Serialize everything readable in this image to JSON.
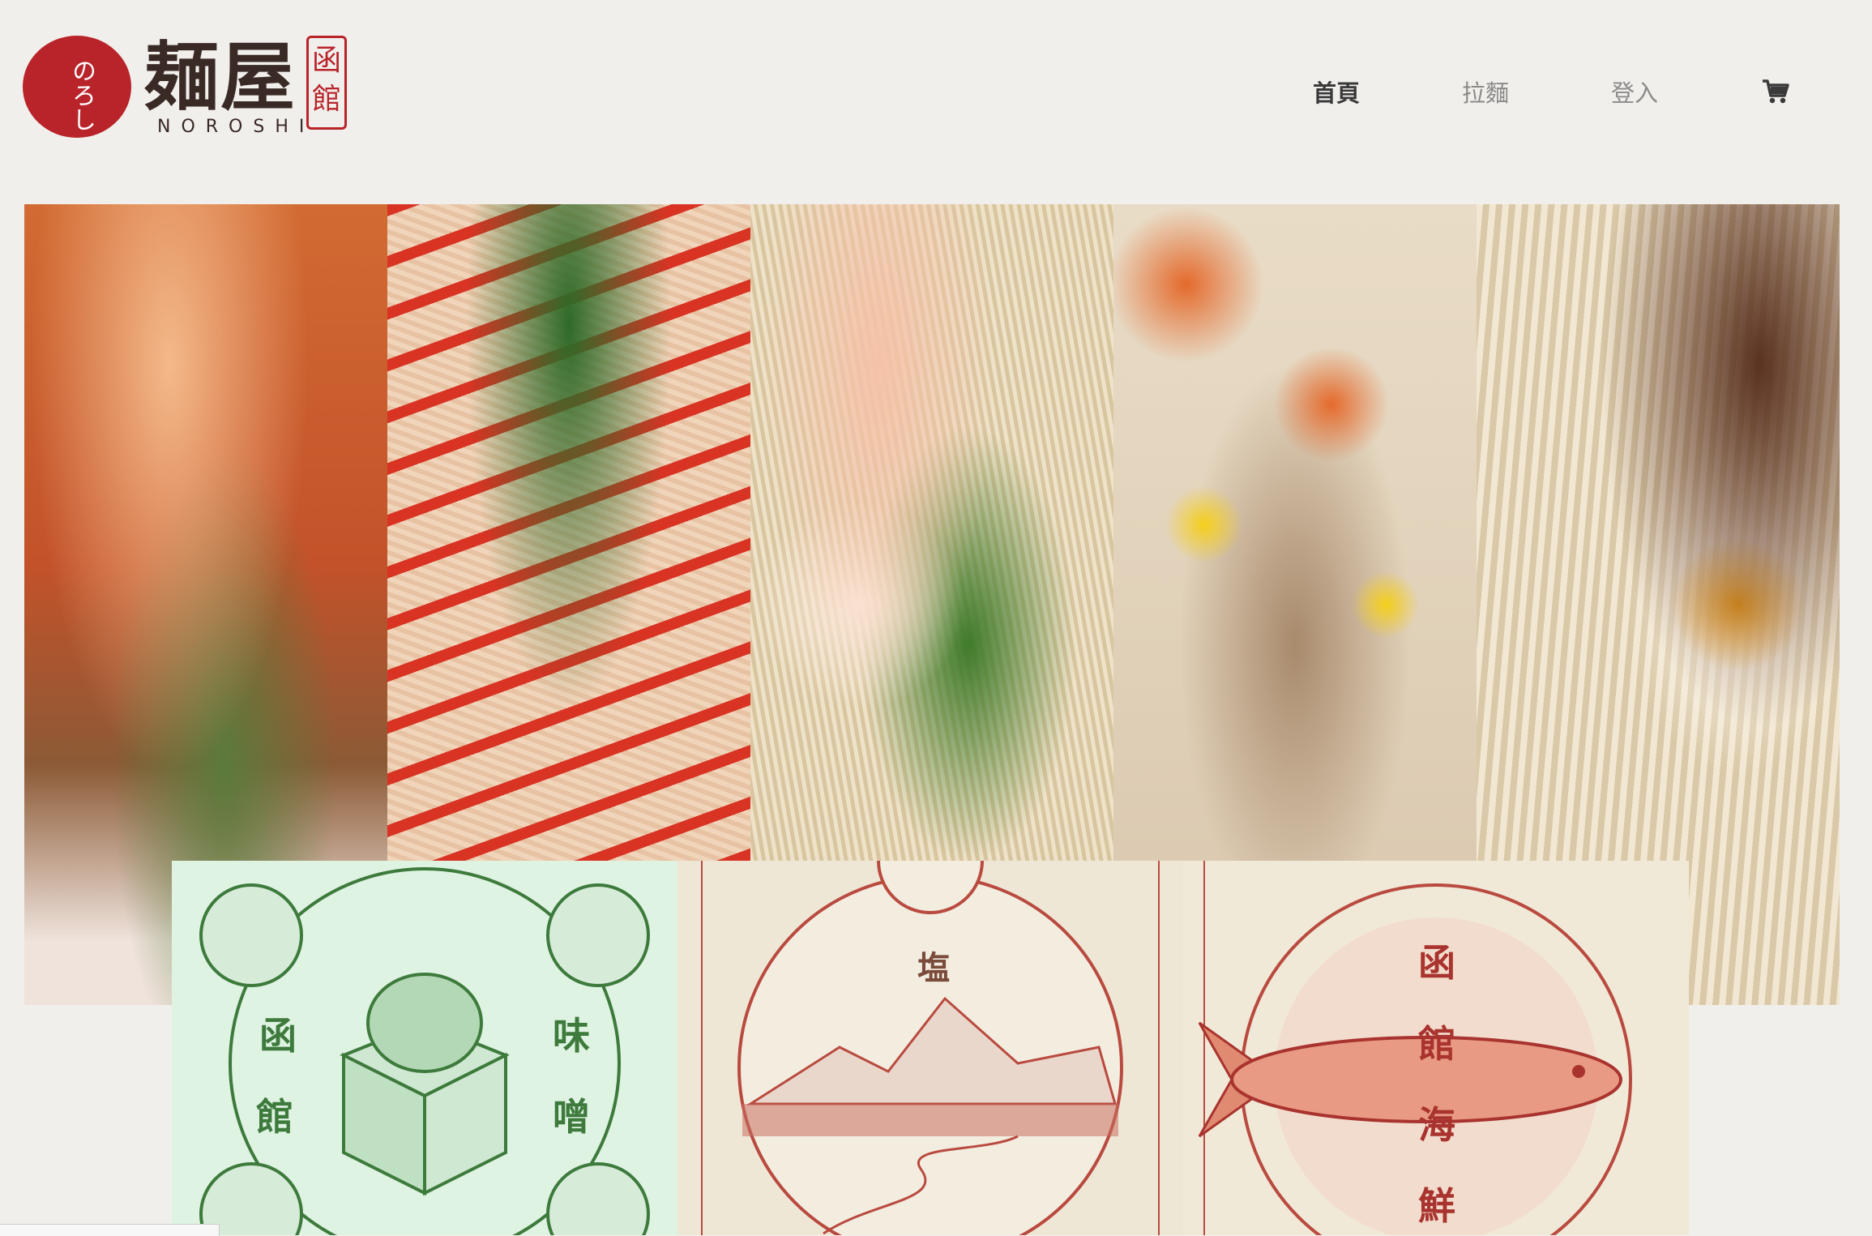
{
  "brand": {
    "kana": "のろし",
    "title": "麺屋",
    "seal": "函館",
    "sub": "NOROSHI",
    "accent": "#b8242a"
  },
  "nav": {
    "items": [
      {
        "label": "首頁",
        "active": true
      },
      {
        "label": "拉麵",
        "active": false
      },
      {
        "label": "登入",
        "active": false
      }
    ],
    "cart_icon": "shopping-cart-icon"
  },
  "cards": {
    "left": {
      "chars": [
        "函",
        "館",
        "味",
        "噌"
      ]
    },
    "middle": {
      "chars": [
        "塩"
      ]
    },
    "right": {
      "chars": [
        "函",
        "館",
        "海",
        "鮮"
      ]
    }
  }
}
